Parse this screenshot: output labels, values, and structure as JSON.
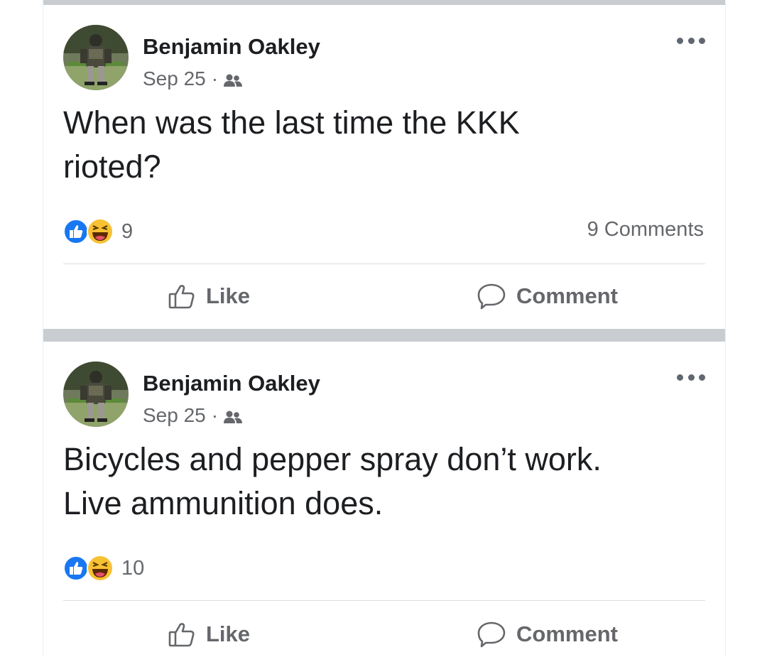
{
  "posts": [
    {
      "author": "Benjamin Oakley",
      "date": "Sep 25",
      "separator": "·",
      "audience_icon": "friends-icon",
      "text_lines": [
        "When was the last time the KKK",
        "rioted?"
      ],
      "reaction_count": "9",
      "comments_count": "9 Comments",
      "like_label": "Like",
      "comment_label": "Comment"
    },
    {
      "author": "Benjamin Oakley",
      "date": "Sep 25",
      "separator": "·",
      "audience_icon": "friends-icon",
      "text_lines": [
        "Bicycles and pepper spray don’t work.",
        "Live ammunition does."
      ],
      "reaction_count": "10",
      "comments_count": "",
      "like_label": "Like",
      "comment_label": "Comment"
    }
  ],
  "colors": {
    "like_blue": "#1877f2",
    "haha_yellow": "#f7c134",
    "secondary_text": "#65676b",
    "separator": "#c9ccd1"
  }
}
